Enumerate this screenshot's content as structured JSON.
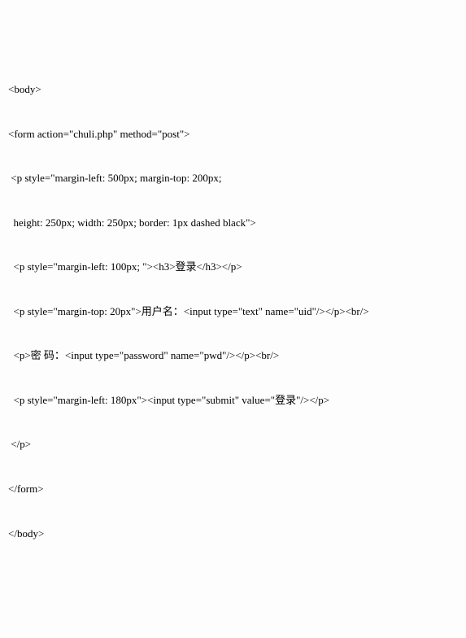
{
  "code": {
    "l1": "<body>",
    "l2": "",
    "l3": "<form action=\"chuli.php\" method=\"post\">",
    "l4": "",
    "l5": " <p style=\"margin-left: 500px; margin-top: 200px;",
    "l6": "",
    "l7": "  height: 250px; width: 250px; border: 1px dashed black\">",
    "l8": "",
    "l9": "  <p style=\"margin-left: 100px; \"><h3>登录</h3></p>",
    "l10": "",
    "l11": "  <p style=\"margin-top: 20px\">用户名：<input type=\"text\" name=\"uid\"/></p><br/>",
    "l12": "",
    "l13": "  <p>密 码：<input type=\"password\" name=\"pwd\"/></p><br/>",
    "l14": "",
    "l15": "  <p style=\"margin-left: 180px\"><input type=\"submit\" value=\"登录\"/></p>",
    "l16": "",
    "l17": " </p>",
    "l18": "",
    "l19": "</form>",
    "l20": "",
    "l21": "</body>"
  }
}
